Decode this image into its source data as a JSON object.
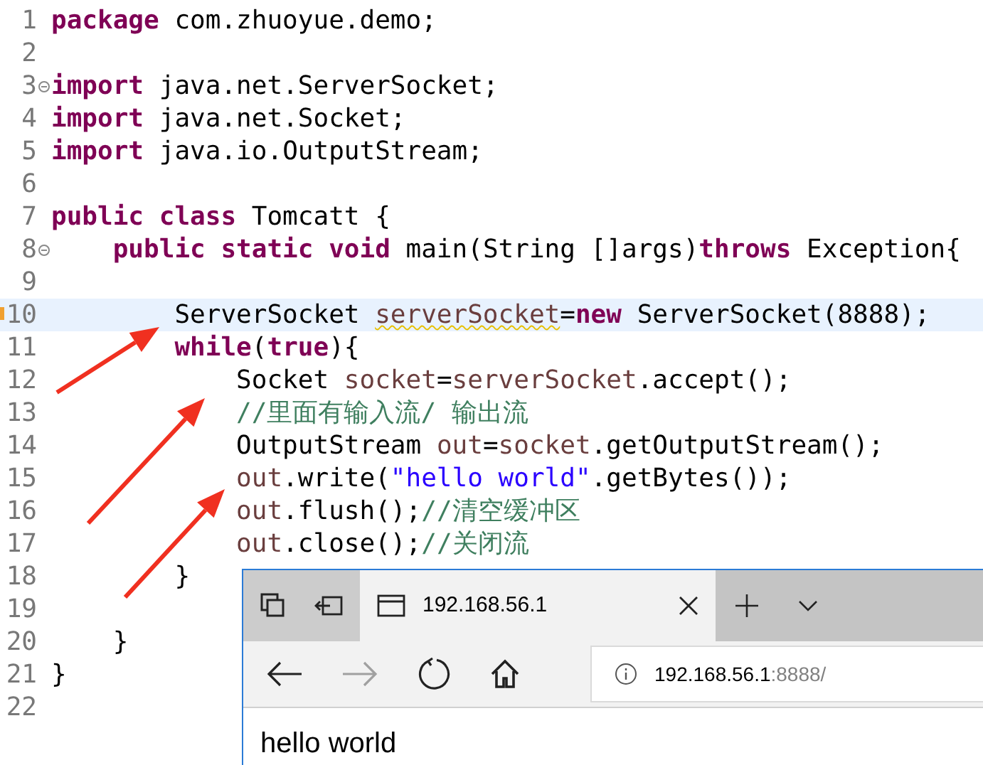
{
  "editor": {
    "lines": [
      {
        "number": "1",
        "tokens": [
          {
            "kind": "keyword",
            "text": "package"
          },
          {
            "kind": "plain",
            "text": " com.zhuoyue.demo;"
          }
        ]
      },
      {
        "number": "2"
      },
      {
        "number": "3",
        "fold": true,
        "tokens": [
          {
            "kind": "keyword",
            "text": "import"
          },
          {
            "kind": "plain",
            "text": " java.net.ServerSocket;"
          }
        ]
      },
      {
        "number": "4",
        "tokens": [
          {
            "kind": "keyword",
            "text": "import"
          },
          {
            "kind": "plain",
            "text": " java.net.Socket;"
          }
        ]
      },
      {
        "number": "5",
        "tokens": [
          {
            "kind": "keyword",
            "text": "import"
          },
          {
            "kind": "plain",
            "text": " java.io.OutputStream;"
          }
        ]
      },
      {
        "number": "6"
      },
      {
        "number": "7",
        "tokens": [
          {
            "kind": "keyword",
            "text": "public class"
          },
          {
            "kind": "plain",
            "text": " Tomcatt {"
          }
        ]
      },
      {
        "number": "8",
        "fold": true,
        "tokens": [
          {
            "kind": "keyword",
            "text": "    public static void"
          },
          {
            "kind": "plain",
            "text": " main(String []args)"
          },
          {
            "kind": "keyword",
            "text": "throws"
          },
          {
            "kind": "plain",
            "text": " Exception{"
          }
        ]
      },
      {
        "number": "9"
      },
      {
        "number": "10",
        "current": true,
        "warning": true,
        "tokens": [
          {
            "kind": "plain",
            "text": "        ServerSocket "
          },
          {
            "kind": "variable",
            "text": "serverSocket",
            "squiggle": true
          },
          {
            "kind": "plain",
            "text": "="
          },
          {
            "kind": "keyword",
            "text": "new"
          },
          {
            "kind": "plain",
            "text": " ServerSocket(8888);"
          }
        ]
      },
      {
        "number": "11",
        "tokens": [
          {
            "kind": "keyword",
            "text": "        while"
          },
          {
            "kind": "plain",
            "text": "("
          },
          {
            "kind": "keyword",
            "text": "true"
          },
          {
            "kind": "plain",
            "text": "){"
          }
        ]
      },
      {
        "number": "12",
        "tokens": [
          {
            "kind": "plain",
            "text": "            Socket "
          },
          {
            "kind": "variable",
            "text": "socket"
          },
          {
            "kind": "plain",
            "text": "="
          },
          {
            "kind": "variable",
            "text": "serverSocket"
          },
          {
            "kind": "plain",
            "text": ".accept();"
          }
        ]
      },
      {
        "number": "13",
        "tokens": [
          {
            "kind": "comment",
            "text": "            //里面有输入流/ 输出流"
          }
        ]
      },
      {
        "number": "14",
        "tokens": [
          {
            "kind": "plain",
            "text": "            OutputStream "
          },
          {
            "kind": "variable",
            "text": "out"
          },
          {
            "kind": "plain",
            "text": "="
          },
          {
            "kind": "variable",
            "text": "socket"
          },
          {
            "kind": "plain",
            "text": ".getOutputStream();"
          }
        ]
      },
      {
        "number": "15",
        "tokens": [
          {
            "kind": "variable",
            "text": "            out"
          },
          {
            "kind": "plain",
            "text": ".write("
          },
          {
            "kind": "string",
            "text": "\"hello world\""
          },
          {
            "kind": "plain",
            "text": ".getBytes());"
          }
        ]
      },
      {
        "number": "16",
        "tokens": [
          {
            "kind": "variable",
            "text": "            out"
          },
          {
            "kind": "plain",
            "text": ".flush();"
          },
          {
            "kind": "comment",
            "text": "//清空缓冲区"
          }
        ]
      },
      {
        "number": "17",
        "tokens": [
          {
            "kind": "variable",
            "text": "            out"
          },
          {
            "kind": "plain",
            "text": ".close();"
          },
          {
            "kind": "comment",
            "text": "//关闭流"
          }
        ]
      },
      {
        "number": "18",
        "tokens": [
          {
            "kind": "plain",
            "text": "        }"
          }
        ]
      },
      {
        "number": "19"
      },
      {
        "number": "20",
        "tokens": [
          {
            "kind": "plain",
            "text": "    }"
          }
        ]
      },
      {
        "number": "21",
        "tokens": [
          {
            "kind": "plain",
            "text": "}"
          }
        ]
      },
      {
        "number": "22"
      }
    ]
  },
  "browser": {
    "tab": {
      "title": "192.168.56.1",
      "selected": true
    },
    "forward_disabled": true,
    "address": {
      "host": "192.168.56.1",
      "rest": ":8888/"
    },
    "page_text": "hello world"
  }
}
